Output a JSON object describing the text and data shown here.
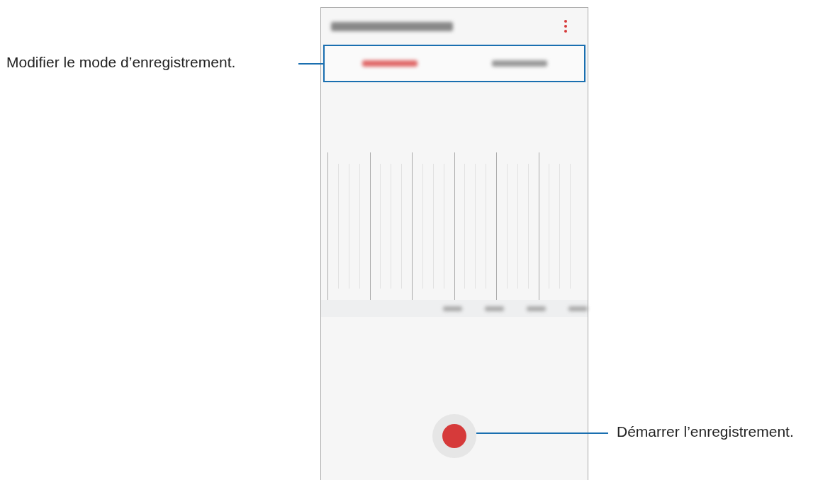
{
  "callouts": [
    {
      "text": "Modifier le mode d’enregistrement."
    },
    {
      "text": "Démarrer l’enregistrement."
    }
  ],
  "tabs": [
    {
      "selected": true
    },
    {
      "selected": false
    }
  ]
}
